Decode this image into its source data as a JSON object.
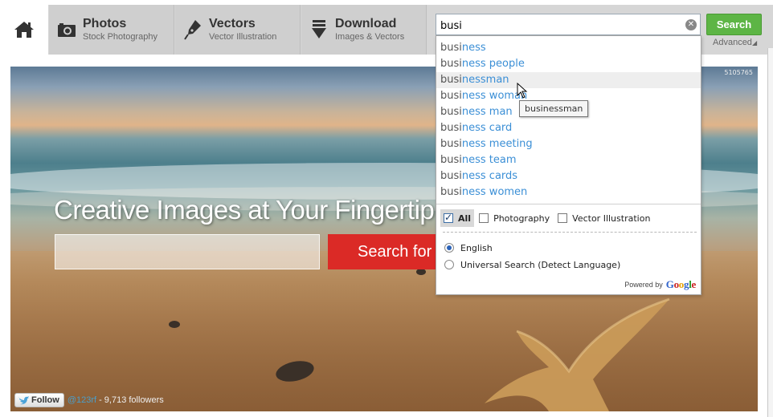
{
  "nav": {
    "home_icon": "home-icon",
    "tabs": [
      {
        "title": "Photos",
        "subtitle": "Stock Photography",
        "icon": "camera-icon"
      },
      {
        "title": "Vectors",
        "subtitle": "Vector Illustration",
        "icon": "pen-nib-icon"
      },
      {
        "title": "Download",
        "subtitle": "Images & Vectors",
        "icon": "download-icon"
      }
    ]
  },
  "search": {
    "value": "busi",
    "button_label": "Search",
    "advanced_label": "Advanced",
    "clear_icon": "clear-icon"
  },
  "autocomplete": {
    "typed": "busi",
    "suggestions": [
      {
        "typed": "busi",
        "completion": "ness"
      },
      {
        "typed": "busi",
        "completion": "ness people"
      },
      {
        "typed": "busi",
        "completion": "nessman"
      },
      {
        "typed": "busi",
        "completion": "ness woman"
      },
      {
        "typed": "busi",
        "completion": "ness man"
      },
      {
        "typed": "busi",
        "completion": "ness card"
      },
      {
        "typed": "busi",
        "completion": "ness meeting"
      },
      {
        "typed": "busi",
        "completion": "ness team"
      },
      {
        "typed": "busi",
        "completion": "ness cards"
      },
      {
        "typed": "busi",
        "completion": "ness women"
      }
    ],
    "highlighted_index": 2,
    "tooltip": "businessman",
    "filters": [
      {
        "label": "All",
        "checked": true
      },
      {
        "label": "Photography",
        "checked": false
      },
      {
        "label": "Vector Illustration",
        "checked": false
      }
    ],
    "languages": [
      {
        "label": "English",
        "selected": true
      },
      {
        "label": "Universal Search (Detect Language)",
        "selected": false
      }
    ],
    "powered_by": "Powered by",
    "powered_brand": "Google"
  },
  "hero": {
    "title": "Creative Images at Your Fingertip",
    "search_button": "Search for",
    "image_id": "5105765"
  },
  "social": {
    "follow_label": "Follow",
    "handle": "@123rf",
    "followers": "- 9,713 followers"
  },
  "colors": {
    "search_green": "#5db545",
    "hero_red": "#db2a26",
    "link_blue": "#3b8fd6",
    "nav_gray": "#cfcfcf"
  }
}
